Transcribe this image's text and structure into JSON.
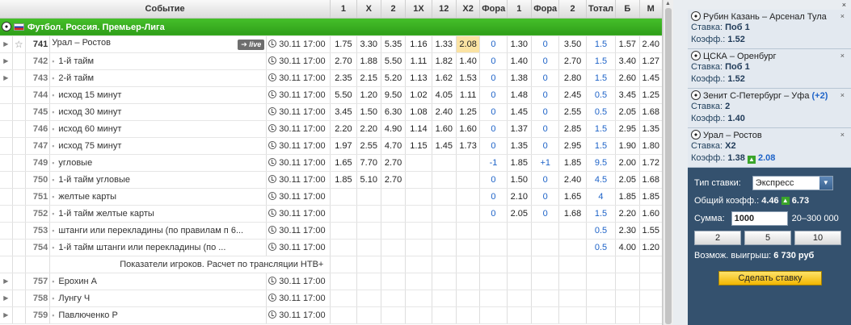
{
  "columns": [
    "",
    "Событие",
    "1",
    "X",
    "2",
    "1X",
    "12",
    "X2",
    "Фора",
    "1",
    "Фора",
    "2",
    "Тотал",
    "Б",
    "М"
  ],
  "league": "Футбол. Россия. Премьер-Лига",
  "live_label": "live",
  "rows": [
    {
      "num": "741",
      "event": "Урал – Ростов",
      "time": "30.11 17:00",
      "c1": "1.75",
      "cx": "3.30",
      "c2": "5.35",
      "c1x": "1.16",
      "c12": "1.33",
      "cx2": "2.08",
      "f1": "0",
      "k1": "1.30",
      "f2": "0",
      "k2": "3.50",
      "tot": "1.5",
      "b": "1.57",
      "m": "2.40"
    },
    {
      "num": "742",
      "event": "1-й тайм",
      "time": "30.11 17:00",
      "c1": "2.70",
      "cx": "1.88",
      "c2": "5.50",
      "c1x": "1.11",
      "c12": "1.82",
      "cx2": "1.40",
      "f1": "0",
      "k1": "1.40",
      "f2": "0",
      "k2": "2.70",
      "tot": "1.5",
      "b": "3.40",
      "m": "1.27"
    },
    {
      "num": "743",
      "event": "2-й тайм",
      "time": "30.11 17:00",
      "c1": "2.35",
      "cx": "2.15",
      "c2": "5.20",
      "c1x": "1.13",
      "c12": "1.62",
      "cx2": "1.53",
      "f1": "0",
      "k1": "1.38",
      "f2": "0",
      "k2": "2.80",
      "tot": "1.5",
      "b": "2.60",
      "m": "1.45"
    },
    {
      "num": "744",
      "event": "исход 15 минут",
      "time": "30.11 17:00",
      "c1": "5.50",
      "cx": "1.20",
      "c2": "9.50",
      "c1x": "1.02",
      "c12": "4.05",
      "cx2": "1.11",
      "f1": "0",
      "k1": "1.48",
      "f2": "0",
      "k2": "2.45",
      "tot": "0.5",
      "b": "3.45",
      "m": "1.25"
    },
    {
      "num": "745",
      "event": "исход 30 минут",
      "time": "30.11 17:00",
      "c1": "3.45",
      "cx": "1.50",
      "c2": "6.30",
      "c1x": "1.08",
      "c12": "2.40",
      "cx2": "1.25",
      "f1": "0",
      "k1": "1.45",
      "f2": "0",
      "k2": "2.55",
      "tot": "0.5",
      "b": "2.05",
      "m": "1.68"
    },
    {
      "num": "746",
      "event": "исход 60 минут",
      "time": "30.11 17:00",
      "c1": "2.20",
      "cx": "2.20",
      "c2": "4.90",
      "c1x": "1.14",
      "c12": "1.60",
      "cx2": "1.60",
      "f1": "0",
      "k1": "1.37",
      "f2": "0",
      "k2": "2.85",
      "tot": "1.5",
      "b": "2.95",
      "m": "1.35"
    },
    {
      "num": "747",
      "event": "исход 75 минут",
      "time": "30.11 17:00",
      "c1": "1.97",
      "cx": "2.55",
      "c2": "4.70",
      "c1x": "1.15",
      "c12": "1.45",
      "cx2": "1.73",
      "f1": "0",
      "k1": "1.35",
      "f2": "0",
      "k2": "2.95",
      "tot": "1.5",
      "b": "1.90",
      "m": "1.80"
    },
    {
      "num": "749",
      "event": "угловые",
      "time": "30.11 17:00",
      "c1": "1.65",
      "cx": "7.70",
      "c2": "2.70",
      "c1x": "",
      "c12": "",
      "cx2": "",
      "f1": "-1",
      "k1": "1.85",
      "f2": "+1",
      "k2": "1.85",
      "tot": "9.5",
      "b": "2.00",
      "m": "1.72"
    },
    {
      "num": "750",
      "event": "1-й тайм угловые",
      "time": "30.11 17:00",
      "c1": "1.85",
      "cx": "5.10",
      "c2": "2.70",
      "c1x": "",
      "c12": "",
      "cx2": "",
      "f1": "0",
      "k1": "1.50",
      "f2": "0",
      "k2": "2.40",
      "tot": "4.5",
      "b": "2.05",
      "m": "1.68"
    },
    {
      "num": "751",
      "event": "желтые карты",
      "time": "30.11 17:00",
      "c1": "",
      "cx": "",
      "c2": "",
      "c1x": "",
      "c12": "",
      "cx2": "",
      "f1": "0",
      "k1": "2.10",
      "f2": "0",
      "k2": "1.65",
      "tot": "4",
      "b": "1.85",
      "m": "1.85"
    },
    {
      "num": "752",
      "event": "1-й тайм желтые карты",
      "time": "30.11 17:00",
      "c1": "",
      "cx": "",
      "c2": "",
      "c1x": "",
      "c12": "",
      "cx2": "",
      "f1": "0",
      "k1": "2.05",
      "f2": "0",
      "k2": "1.68",
      "tot": "1.5",
      "b": "2.20",
      "m": "1.60"
    },
    {
      "num": "753",
      "event": "штанги или перекладины (по правилам п 6...",
      "time": "30.11 17:00",
      "c1": "",
      "cx": "",
      "c2": "",
      "c1x": "",
      "c12": "",
      "cx2": "",
      "f1": "",
      "k1": "",
      "f2": "",
      "k2": "",
      "tot": "0.5",
      "b": "2.30",
      "m": "1.55"
    },
    {
      "num": "754",
      "event": "1-й тайм штанги или перекладины (по ...",
      "time": "30.11 17:00",
      "c1": "",
      "cx": "",
      "c2": "",
      "c1x": "",
      "c12": "",
      "cx2": "",
      "f1": "",
      "k1": "",
      "f2": "",
      "k2": "",
      "tot": "0.5",
      "b": "4.00",
      "m": "1.20"
    },
    {
      "num": "757",
      "event": "Ерохин А",
      "time": "30.11 17:00"
    },
    {
      "num": "758",
      "event": "Лунгу Ч",
      "time": "30.11 17:00"
    },
    {
      "num": "759",
      "event": "Павлюченко Р",
      "time": "30.11 17:00"
    }
  ],
  "info_row": "Показатели игроков. Расчет по трансляции НТВ+",
  "slip": {
    "close": "×",
    "bets": [
      {
        "title": "Рубин Казань – Арсенал Тула",
        "stake_label": "Ставка:",
        "stake": "Поб 1",
        "coef_label": "Коэфф.:",
        "coef": "1.52"
      },
      {
        "title": "ЦСКА – Оренбург",
        "stake_label": "Ставка:",
        "stake": "Поб 1",
        "coef_label": "Коэфф.:",
        "coef": "1.52"
      },
      {
        "title": "Зенит С-Петербург – Уфа",
        "title_extra": "(+2)",
        "stake_label": "Ставка:",
        "stake": "2",
        "coef_label": "Коэфф.:",
        "coef": "1.40"
      },
      {
        "title": "Урал – Ростов",
        "stake_label": "Ставка:",
        "stake": "X2",
        "coef_label": "Коэфф.:",
        "coef": "1.38",
        "coef_new": "2.08"
      }
    ],
    "type_label": "Тип ставки:",
    "type_value": "Экспресс",
    "total_label": "Общий коэфф.:",
    "total_value": "4.46",
    "total_new": "6.73",
    "sum_label": "Сумма:",
    "sum_value": "1000",
    "sum_range": "20–300 000",
    "quick": [
      "2",
      "5",
      "10"
    ],
    "win_label": "Возмож. выигрыш:",
    "win_value": "6 730 руб",
    "submit": "Сделать ставку"
  }
}
